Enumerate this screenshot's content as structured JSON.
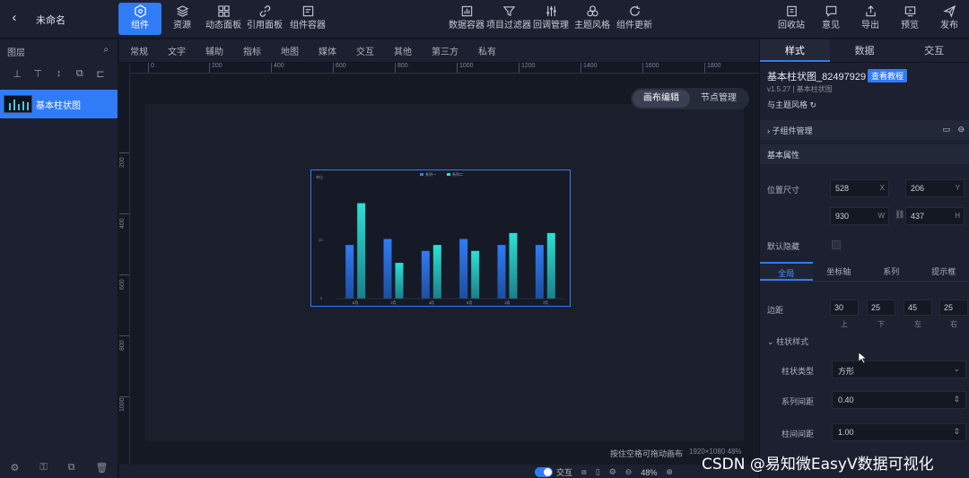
{
  "top": {
    "back_icon": "back-arrow-icon",
    "project_name": "未命名",
    "left_buttons": [
      {
        "label": "组件",
        "icon": "cube-icon",
        "active": true
      },
      {
        "label": "资源",
        "icon": "layers-icon",
        "active": false
      },
      {
        "label": "动态面板",
        "icon": "grid-icon",
        "active": false
      },
      {
        "label": "引用面板",
        "icon": "link-icon",
        "active": false
      },
      {
        "label": "组件容器",
        "icon": "container-icon",
        "active": false
      }
    ],
    "center_buttons": [
      {
        "label": "数据容器",
        "icon": "data-icon"
      },
      {
        "label": "项目过滤器",
        "icon": "filter-icon"
      },
      {
        "label": "回调管理",
        "icon": "sliders-icon"
      },
      {
        "label": "主题风格",
        "icon": "palette-icon"
      },
      {
        "label": "组件更新",
        "icon": "refresh-icon"
      }
    ],
    "right_buttons": [
      {
        "label": "回收站",
        "icon": "trash-bin-icon"
      },
      {
        "label": "意见",
        "icon": "feedback-icon"
      },
      {
        "label": "导出",
        "icon": "export-icon"
      },
      {
        "label": "预览",
        "icon": "preview-icon"
      },
      {
        "label": "发布",
        "icon": "publish-icon"
      }
    ]
  },
  "left_panel": {
    "title": "图层",
    "layer_name": "基本柱状图",
    "tools": [
      "⊥",
      "⊤",
      "↕",
      "⧉",
      "⊏"
    ]
  },
  "center": {
    "tabs": [
      "常规",
      "文字",
      "辅助",
      "指标",
      "地图",
      "媒体",
      "交互",
      "其他",
      "第三方",
      "私有"
    ],
    "ruler_h": [
      "0",
      "200",
      "400",
      "600",
      "800",
      "1000",
      "1200",
      "1400",
      "1600",
      "1800"
    ],
    "ruler_v": [
      "200",
      "400",
      "600",
      "800",
      "1000"
    ],
    "mode": {
      "canvas_edit": "画布编辑",
      "node_manage": "节点管理"
    },
    "status_hint": "按住空格可拖动画布",
    "status_size": "1920×1080 48%",
    "interact_label": "交互",
    "zoom": "48%"
  },
  "right_panel": {
    "tabs": [
      "样式",
      "数据",
      "交互"
    ],
    "component_title": "基本柱状图_82497929",
    "doc_badge": "查看教程",
    "version": "v1.5.27 | 基本柱状图",
    "theme_link": "与主题风格 ↻",
    "child_manage": "子组件管理",
    "basic_props": "基本属性",
    "position_label": "位置尺寸",
    "pos_x": "528",
    "pos_y": "206",
    "width": "930",
    "height": "437",
    "unit_x": "X",
    "unit_y": "Y",
    "unit_w": "W",
    "unit_h": "H",
    "hidden_label": "默认隐藏",
    "sub_tabs": [
      "全局",
      "坐标轴",
      "系列",
      "提示框"
    ],
    "margin_label": "边距",
    "margins": [
      "30",
      "25",
      "45",
      "25"
    ],
    "margin_caps": [
      "上",
      "下",
      "左",
      "右"
    ],
    "bar_style": "柱状样式",
    "bar_type_label": "柱状类型",
    "bar_type_value": "方形",
    "series_gap_label": "系列间距",
    "series_gap_value": "0.40",
    "bar_gap_label": "柱间间距",
    "bar_gap_value": "1.00"
  },
  "watermark": "CSDN @易知微EasyV数据可视化",
  "chart_data": {
    "type": "bar",
    "categories": [
      "6月",
      "2月",
      "4月",
      "5月",
      "3月",
      "7月"
    ],
    "series": [
      {
        "name": "系列一",
        "values": [
          18,
          20,
          16,
          20,
          18,
          18
        ],
        "color": "#2f7cf6"
      },
      {
        "name": "系列二",
        "values": [
          32,
          12,
          18,
          16,
          22,
          22
        ],
        "color": "#2ce0d4"
      }
    ],
    "ylim": [
      0,
      40
    ],
    "yticks": [
      "0",
      "20"
    ],
    "legend_position": "top-center",
    "unit": "单位"
  },
  "colors": {
    "accent": "#2f7cf6",
    "bar_a": "#2f7cf6",
    "bar_b": "#2ce0d4"
  }
}
